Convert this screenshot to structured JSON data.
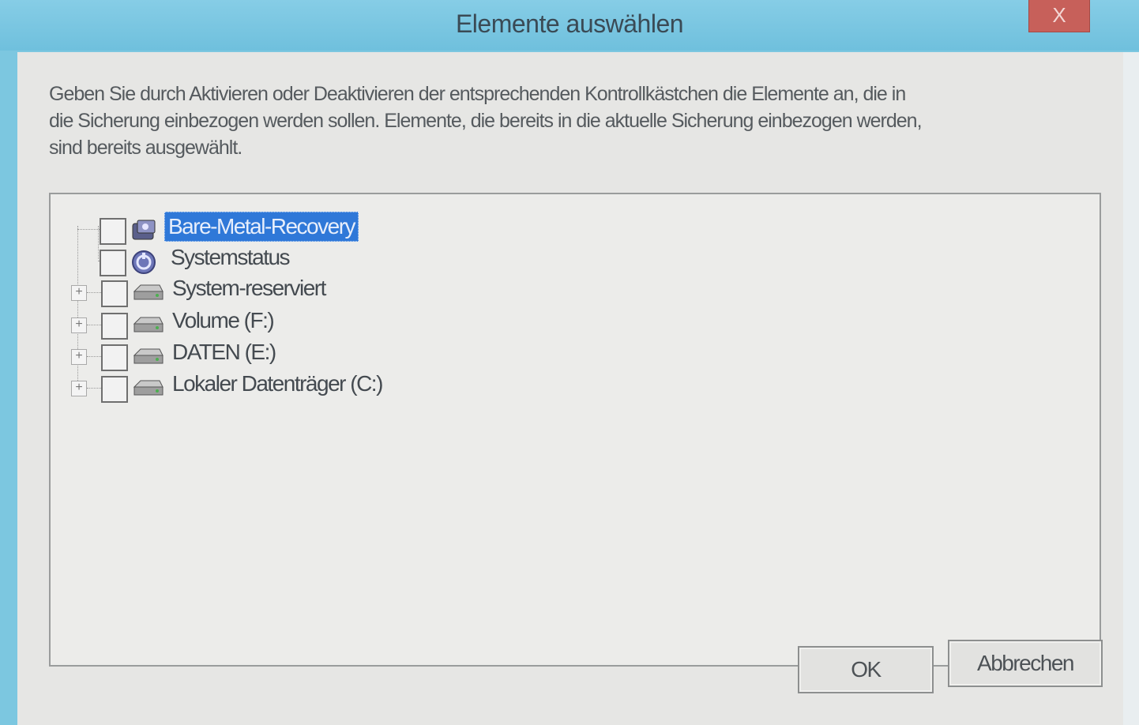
{
  "window": {
    "title": "Elemente auswählen",
    "close_label": "X"
  },
  "instructions": {
    "lines": [
      "Geben Sie durch Aktivieren oder Deaktivieren der entsprechenden Kontrollkästchen die Elemente an, die in",
      "die Sicherung einbezogen werden sollen. Elemente, die bereits in die aktuelle Sicherung einbezogen werden,",
      "sind bereits ausgewählt."
    ]
  },
  "tree": {
    "items": [
      {
        "label": "Bare-Metal-Recovery",
        "checked": false,
        "expandable": false,
        "selected": true,
        "icon": "bare-metal-recovery-icon"
      },
      {
        "label": "Systemstatus",
        "checked": false,
        "expandable": false,
        "selected": false,
        "icon": "system-state-icon"
      },
      {
        "label": "System-reserviert",
        "checked": false,
        "expandable": true,
        "selected": false,
        "icon": "drive-icon"
      },
      {
        "label": "Volume (F:)",
        "checked": false,
        "expandable": true,
        "selected": false,
        "icon": "drive-icon"
      },
      {
        "label": "DATEN (E:)",
        "checked": false,
        "expandable": true,
        "selected": false,
        "icon": "drive-icon"
      },
      {
        "label": "Lokaler Datenträger (C:)",
        "checked": false,
        "expandable": true,
        "selected": false,
        "icon": "drive-icon"
      }
    ]
  },
  "buttons": {
    "ok_label": "OK",
    "cancel_label": "Abbrechen"
  },
  "colors": {
    "titlebar": "#7cc7e0",
    "selection": "#2f78d8",
    "close": "#c7605a"
  }
}
